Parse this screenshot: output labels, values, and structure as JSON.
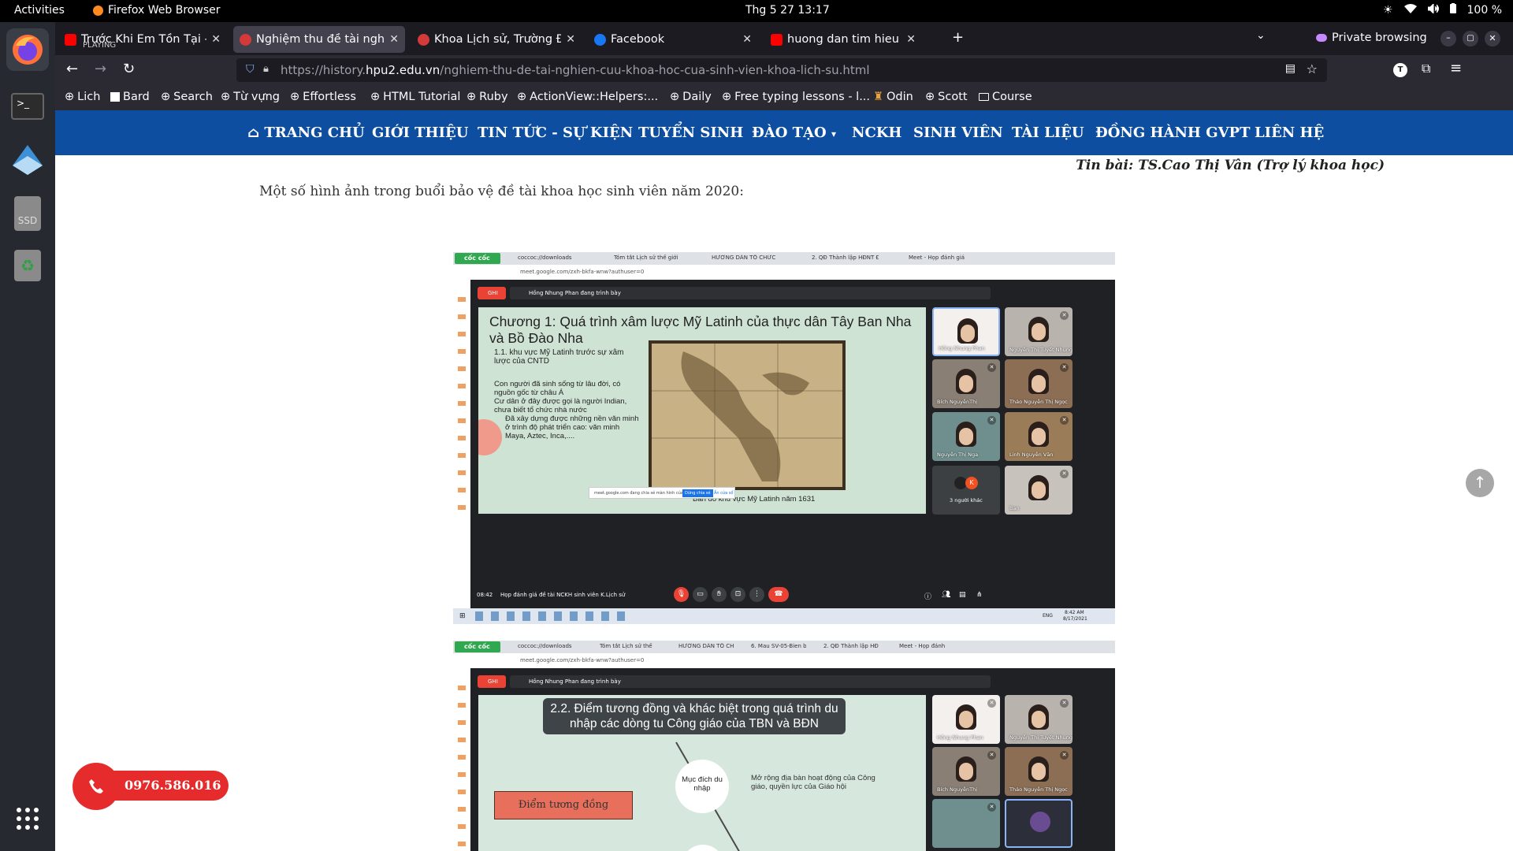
{
  "system": {
    "activities": "Activities",
    "app_name": "Firefox Web Browser",
    "clock": "Thg 5 27  13:17",
    "battery": "100 %"
  },
  "tabs": [
    {
      "title": "Trước Khi Em Tồn Tại - Yo",
      "sub": "PLAYING",
      "favicon_color": "#ff0000",
      "active": false
    },
    {
      "title": "Nghiệm thu đề tài nghiên",
      "sub": "",
      "favicon_color": "#d43a3a",
      "active": true
    },
    {
      "title": "Khoa Lịch sử, Trường ĐH",
      "sub": "",
      "favicon_color": "#d43a3a",
      "active": false
    },
    {
      "title": "Facebook",
      "sub": "",
      "favicon_color": "#1877f2",
      "active": false
    },
    {
      "title": "huong dan tim hieu nghie",
      "sub": "",
      "favicon_color": "#ff0000",
      "active": false
    }
  ],
  "private_label": "Private browsing",
  "url": {
    "prefix": "https://history.",
    "domain": "hpu2.edu.vn",
    "path": "/nghiem-thu-de-tai-nghien-cuu-khoa-hoc-cua-sinh-vien-khoa-lich-su.html"
  },
  "bookmarks": [
    "Lich",
    "Bard",
    "Search",
    "Từ vựng",
    "Effortless",
    "HTML Tutorial",
    "Ruby",
    "ActionView::Helpers:...",
    "Daily",
    "Free typing lessons - l...",
    "Odin",
    "Scott",
    "Course"
  ],
  "site_nav": [
    "TRANG CHỦ",
    "GIỚI THIỆU",
    "TIN TỨC - SỰ KIỆN",
    "TUYỂN SINH",
    "ĐÀO TẠO",
    "NCKH",
    "SINH VIÊN",
    "TÀI LIỆU",
    "ĐỒNG HÀNH GVPT",
    "LIÊN HỆ"
  ],
  "byline": "Tin bài: TS.Cao Thị Vân (Trợ lý khoa học)",
  "intro": "Một số hình ảnh trong buổi bảo vệ đề tài khoa học sinh viên năm 2020:",
  "shot1": {
    "brand": "cốc cốc",
    "tabs": [
      "coccoc://downloads",
      "Tóm tắt Lịch sử thế giới",
      "HƯỚNG DẪN TỔ CHỨC",
      "2. QĐ Thành lập HĐNT ĐT",
      "Meet - Họp đánh giá"
    ],
    "address": "meet.google.com/zxh-bkfa-wnw?authuser=0",
    "record": "GHI",
    "presenting": "Hồng Nhung Phan đang trình bày",
    "slide_title": "Chương 1: Quá trình xâm lược Mỹ Latinh của thực dân Tây Ban Nha và Bồ Đào Nha",
    "slide_sub": "1.1. khu vực Mỹ Latinh trước sự xâm lược của CNTD",
    "bullets": [
      "Con người đã sinh sống từ lâu đời, có nguồn gốc từ châu Á",
      "Cư dân ở đây được gọi là người Indian, chưa biết tổ chức nhà nước",
      "Đã xây dựng được những nền văn minh ở trình độ phát triển cao: văn minh Maya, Aztec, Inca,...."
    ],
    "map_caption": "Bản đồ khu vực Mỹ Latinh năm 1631",
    "share_notice": "meet.google.com đang chia sẻ màn hình của bạn.",
    "share_stop": "Dừng chia sẻ",
    "share_hide": "Ẩn cửa sổ",
    "participants": [
      "Hồng Nhung Phan",
      "Nguyễn Thị Tuyết Nhung",
      "Bích NguyễnThị",
      "Thảo Nguyễn Thị Ngọc",
      "Nguyễn Thị Nga",
      "Linh Nguyễn Văn",
      "3 người khác",
      "Bạn"
    ],
    "meeting_time": "08:42",
    "meeting_name": "Họp đánh giá đề tài NCKH sinh viên K.Lịch sử",
    "taskbar_time": "8:42 AM",
    "taskbar_date": "8/17/2021",
    "taskbar_lang": "ENG"
  },
  "shot2": {
    "brand": "cốc cốc",
    "tabs": [
      "coccoc://downloads",
      "Tóm tắt Lịch sử thế",
      "HƯỚNG DẪN TỔ CH",
      "6. Mau SV-05-Bien b",
      "2. QĐ Thành lập HĐ",
      "Meet - Họp đánh"
    ],
    "address": "meet.google.com/zxh-bkfa-wnw?authuser=0",
    "record": "GHI",
    "presenting": "Hồng Nhung Phan đang trình bày",
    "slide_title": "2.2. Điểm tương đồng và khác biệt trong quá trình du nhập các dòng tu Công giáo của TBN và BĐN",
    "circle_label": "Mục đích du nhập",
    "purpose_text": "Mở rộng địa bàn hoạt động của Công giáo, quyền lực của Giáo hội",
    "box_label": "Điểm tương đồng",
    "participants": [
      "Hồng Nhung Phan",
      "Nguyễn Thị Tuyết Nhung",
      "Bích NguyễnThị",
      "Thảo Nguyễn Thị Ngọc"
    ]
  },
  "phone": "0976.586.016",
  "colors": {
    "site_nav": "#0e4ea1",
    "phone": "#e52b2b"
  }
}
